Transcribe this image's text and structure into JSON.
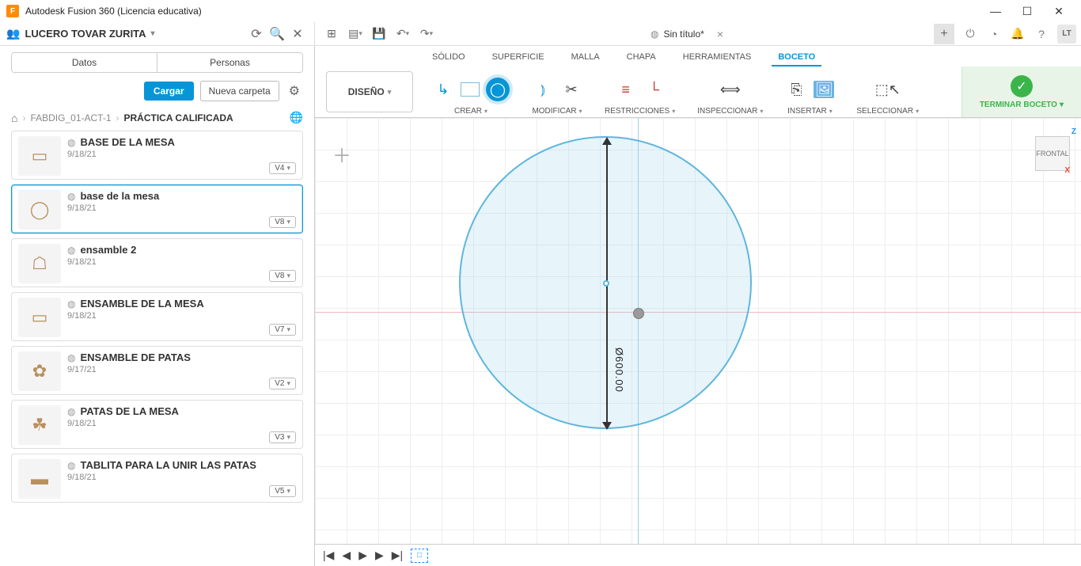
{
  "app": {
    "title": "Autodesk Fusion 360 (Licencia educativa)",
    "logo_letter": "F"
  },
  "window_buttons": {
    "min": "—",
    "max": "☐",
    "close": "✕"
  },
  "user_bar": {
    "name": "LUCERO TOVAR ZURITA",
    "refresh_glyph": "⟳",
    "search_glyph": "🔍",
    "close_glyph": "✕",
    "people_glyph": "👥"
  },
  "qat": {
    "grid": "⊞",
    "file": "▤",
    "save": "💾",
    "undo": "↶",
    "redo": "↷"
  },
  "doc_tab": {
    "icon": "◍",
    "title": "Sin título*",
    "close": "×",
    "add": "+"
  },
  "right_icons": {
    "ext": "⏻",
    "clock": "◔",
    "bell": "🔔",
    "help": "?",
    "avatar": "LT"
  },
  "dp_tabs": {
    "datos": "Datos",
    "personas": "Personas"
  },
  "dp_actions": {
    "cargar": "Cargar",
    "nueva": "Nueva carpeta",
    "gear": "⚙"
  },
  "breadcrumb": {
    "home": "⌂",
    "sep": "›",
    "p1": "FABDIG_01-ACT-1",
    "p2": "PRÁCTICA CALIFICADA",
    "globe": "🌐"
  },
  "files": [
    {
      "title": "BASE DE LA MESA",
      "date": "9/18/21",
      "version": "V4",
      "selected": false,
      "thumb": "▭"
    },
    {
      "title": "base de la mesa",
      "date": "9/18/21",
      "version": "V8",
      "selected": true,
      "thumb": "◯"
    },
    {
      "title": "ensamble 2",
      "date": "9/18/21",
      "version": "V8",
      "selected": false,
      "thumb": "☖"
    },
    {
      "title": "ENSAMBLE DE LA MESA",
      "date": "9/18/21",
      "version": "V7",
      "selected": false,
      "thumb": "▭"
    },
    {
      "title": "ENSAMBLE DE PATAS",
      "date": "9/17/21",
      "version": "V2",
      "selected": false,
      "thumb": "✿"
    },
    {
      "title": "PATAS DE LA MESA",
      "date": "9/18/21",
      "version": "V3",
      "selected": false,
      "thumb": "☘"
    },
    {
      "title": "TABLITA PARA LA UNIR LAS PATAS",
      "date": "9/18/21",
      "version": "V5",
      "selected": false,
      "thumb": "▬"
    }
  ],
  "ribbon_tabs": {
    "solido": "SÓLIDO",
    "superficie": "SUPERFICIE",
    "malla": "MALLA",
    "chapa": "CHAPA",
    "herramientas": "HERRAMIENTAS",
    "boceto": "BOCETO"
  },
  "workspace": {
    "label": "DISEÑO"
  },
  "ribbon_groups": {
    "crear": "CREAR",
    "modificar": "MODIFICAR",
    "restricciones": "RESTRICCIONES",
    "inspeccionar": "INSPECCIONAR",
    "insertar": "INSERTAR",
    "seleccionar": "SELECCIONAR",
    "terminar": "TERMINAR BOCETO"
  },
  "canvas": {
    "dimension": "Ø600.00",
    "viewcube_face": "FRONTAL",
    "axis_z": "Z",
    "axis_x": "X",
    "origin_marker": "＋"
  },
  "timeline": {
    "first": "|◀",
    "prev": "◀",
    "play": "▶",
    "next": "▶",
    "last": "▶|"
  }
}
